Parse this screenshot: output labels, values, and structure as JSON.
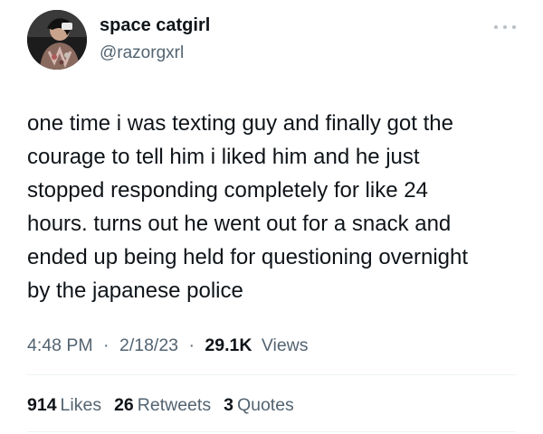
{
  "author": {
    "display_name": "space catgirl",
    "handle": "@razorgxrl"
  },
  "icons": {
    "more": "more-horizontal-icon",
    "avatar": "user-avatar-photo"
  },
  "tweet": {
    "text": "one time i was texting  guy and finally got the\ncourage to tell him i liked him and he just\nstopped responding completely for like 24\nhours. turns out he went out for a snack and\nended up being held for questioning overnight\nby the japanese police"
  },
  "meta": {
    "time": "4:48 PM",
    "separator": "·",
    "date": "2/18/23",
    "views_count": "29.1K",
    "views_label": "Views"
  },
  "stats": {
    "likes_count": "914",
    "likes_label": "Likes",
    "retweets_count": "26",
    "retweets_label": "Retweets",
    "quotes_count": "3",
    "quotes_label": "Quotes"
  },
  "colors": {
    "text_primary": "#0f1419",
    "text_secondary": "#536471",
    "divider": "#eff3f4"
  }
}
